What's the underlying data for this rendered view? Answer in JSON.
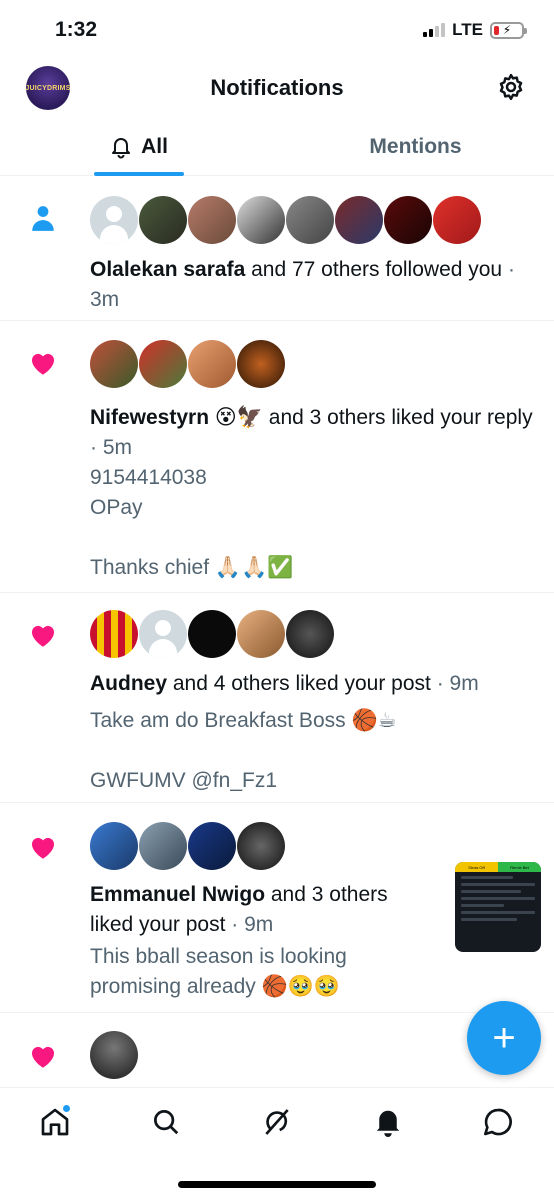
{
  "status_bar": {
    "time": "1:32",
    "network": "LTE"
  },
  "header": {
    "title": "Notifications",
    "avatar_text": "JUICYDRIMS"
  },
  "tabs": [
    {
      "label": "All"
    },
    {
      "label": "Mentions"
    }
  ],
  "notifications": [
    {
      "type": "follow",
      "name": "Olalekan sarafa",
      "action": "and 77 others followed you",
      "time": "· 3m"
    },
    {
      "type": "like",
      "name": "Nifewestyrn 😵🦅",
      "action": "and 3 others liked your reply",
      "time": "· 5m",
      "body": [
        "9154414038",
        "OPay",
        "",
        "Thanks chief 🙏🏻🙏🏻✅"
      ]
    },
    {
      "type": "like",
      "name": "Audney",
      "action": "and 4 others liked your post",
      "time": "· 9m",
      "body": [
        "Take am do Breakfast Boss 🏀☕",
        "",
        "GWFUMV @fn_Fz1"
      ]
    },
    {
      "type": "like",
      "name": "Emmanuel Nwigo",
      "action": "and 3 others liked your post",
      "time": "· 9m",
      "body": [
        "This bball season is looking",
        "promising already 🏀🥹🥹"
      ]
    },
    {
      "type": "like"
    }
  ],
  "thumbnail": {
    "show_off": "Show Off",
    "remix": "Remix Bet"
  },
  "fab": {
    "label": "+"
  },
  "colors": {
    "accent": "#1d9bf0",
    "like": "#f91880",
    "text": "#0f1419",
    "muted": "#536471"
  }
}
